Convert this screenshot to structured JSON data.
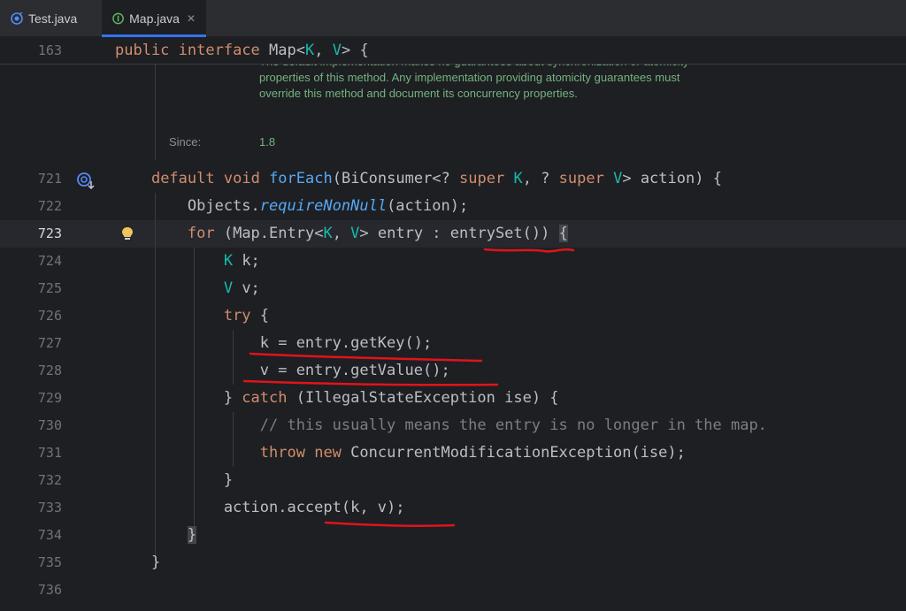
{
  "tabs": [
    {
      "label": "Test.java",
      "active": false
    },
    {
      "label": "Map.java",
      "active": true
    }
  ],
  "sticky_line": {
    "number": "163",
    "tokens": [
      [
        "kw",
        "public"
      ],
      [
        "pl",
        " "
      ],
      [
        "kw",
        "interface"
      ],
      [
        "pl",
        " Map<"
      ],
      [
        "tp",
        "K"
      ],
      [
        "pl",
        ", "
      ],
      [
        "tp",
        "V"
      ],
      [
        "pl",
        "> {"
      ]
    ]
  },
  "doc": {
    "text": "The default implementation makes no guarantees about synchronization or atomicity properties of this method. Any implementation providing atomicity guarantees must override this method and document its concurrency properties.",
    "since_label": "Since:",
    "since_value": "1.8"
  },
  "current_line": "723",
  "lines": [
    {
      "number": "721",
      "tokens": [
        [
          "pl",
          "    "
        ],
        [
          "kw",
          "default"
        ],
        [
          "pl",
          " "
        ],
        [
          "kw",
          "void"
        ],
        [
          "pl",
          " "
        ],
        [
          "fn",
          "forEach"
        ],
        [
          "pl",
          "(BiConsumer<? "
        ],
        [
          "kw",
          "super"
        ],
        [
          "pl",
          " "
        ],
        [
          "tp",
          "K"
        ],
        [
          "pl",
          ", ? "
        ],
        [
          "kw",
          "super"
        ],
        [
          "pl",
          " "
        ],
        [
          "tp",
          "V"
        ],
        [
          "pl",
          "> action) {"
        ]
      ]
    },
    {
      "number": "722",
      "tokens": [
        [
          "pl",
          "        Objects."
        ],
        [
          "st",
          "requireNonNull"
        ],
        [
          "pl",
          "(action);"
        ]
      ]
    },
    {
      "number": "723",
      "tokens": [
        [
          "pl",
          "        "
        ],
        [
          "kw",
          "for"
        ],
        [
          "pl",
          " (Map.Entry<"
        ],
        [
          "tp",
          "K"
        ],
        [
          "pl",
          ", "
        ],
        [
          "tp",
          "V"
        ],
        [
          "pl",
          "> entry : entrySet()) "
        ],
        [
          "br",
          "{"
        ]
      ]
    },
    {
      "number": "724",
      "tokens": [
        [
          "pl",
          "            "
        ],
        [
          "tp",
          "K"
        ],
        [
          "pl",
          " k;"
        ]
      ]
    },
    {
      "number": "725",
      "tokens": [
        [
          "pl",
          "            "
        ],
        [
          "tp",
          "V"
        ],
        [
          "pl",
          " v;"
        ]
      ]
    },
    {
      "number": "726",
      "tokens": [
        [
          "pl",
          "            "
        ],
        [
          "kw",
          "try"
        ],
        [
          "pl",
          " {"
        ]
      ]
    },
    {
      "number": "727",
      "tokens": [
        [
          "pl",
          "                k = entry.getKey();"
        ]
      ]
    },
    {
      "number": "728",
      "tokens": [
        [
          "pl",
          "                v = entry.getValue();"
        ]
      ]
    },
    {
      "number": "729",
      "tokens": [
        [
          "pl",
          "            } "
        ],
        [
          "kw",
          "catch"
        ],
        [
          "pl",
          " (IllegalStateException ise) {"
        ]
      ]
    },
    {
      "number": "730",
      "tokens": [
        [
          "pl",
          "                "
        ],
        [
          "cm",
          "// this usually means the entry is no longer in the map."
        ]
      ]
    },
    {
      "number": "731",
      "tokens": [
        [
          "pl",
          "                "
        ],
        [
          "kw",
          "throw"
        ],
        [
          "pl",
          " "
        ],
        [
          "kw",
          "new"
        ],
        [
          "pl",
          " ConcurrentModificationException(ise);"
        ]
      ]
    },
    {
      "number": "732",
      "tokens": [
        [
          "pl",
          "            }"
        ]
      ]
    },
    {
      "number": "733",
      "tokens": [
        [
          "pl",
          "            action.accept(k, v);"
        ]
      ]
    },
    {
      "number": "734",
      "tokens": [
        [
          "pl",
          "        "
        ],
        [
          "br",
          "}"
        ]
      ]
    },
    {
      "number": "735",
      "tokens": [
        [
          "pl",
          "    }"
        ]
      ]
    },
    {
      "number": "736",
      "tokens": []
    }
  ],
  "icons": {
    "test_tab": "java-test-icon",
    "map_tab": "interface-icon",
    "close": "close-icon",
    "override": "implemented-method-icon",
    "hint": "lightbulb-icon"
  },
  "colors": {
    "keyword": "#cf8e6d",
    "function": "#56a8f5",
    "type_param": "#16baac",
    "comment": "#7a7e85",
    "plain": "#bcbec4",
    "doc": "#73b37e",
    "annotation_ink": "#e0141a"
  }
}
